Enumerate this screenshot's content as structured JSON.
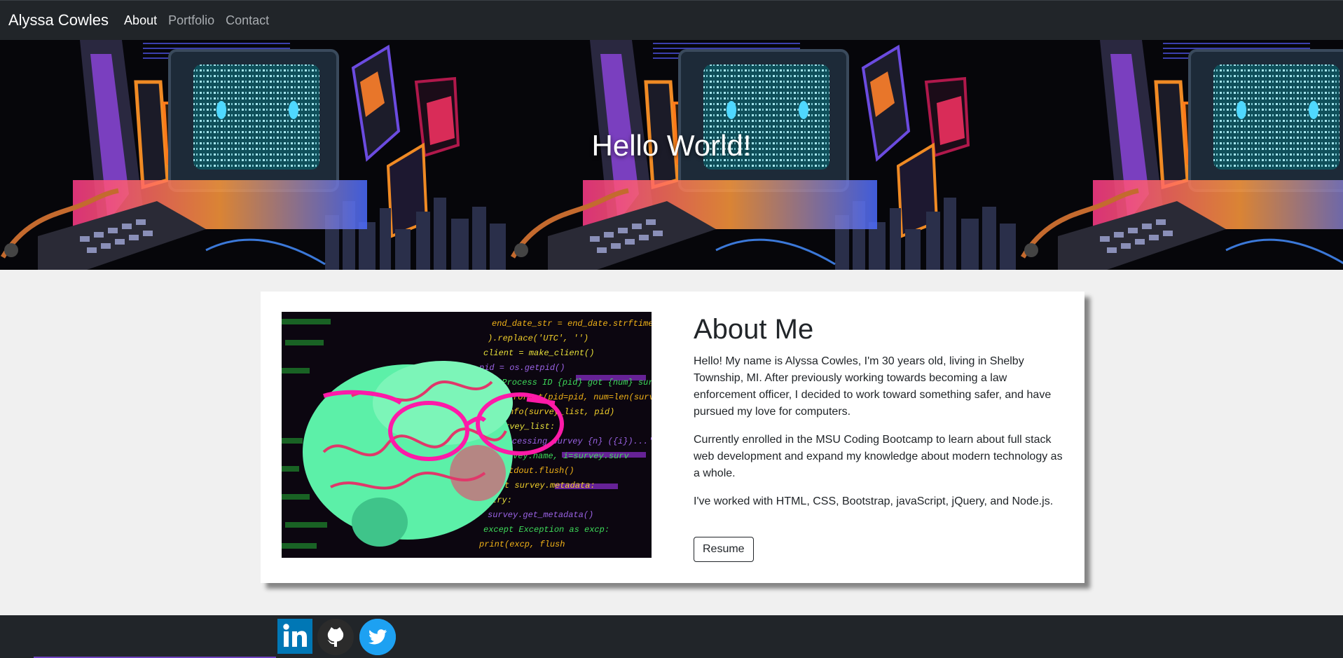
{
  "nav": {
    "brand": "Alyssa Cowles",
    "links": [
      "About",
      "Portfolio",
      "Contact"
    ],
    "active": "About"
  },
  "hero": {
    "title": "Hello World!"
  },
  "about": {
    "title": "About Me",
    "paragraphs": [
      "Hello! My name is Alyssa Cowles, I'm 30 years old, living in Shelby Township, MI. After previously working towards becoming a law enforcement officer, I decided to work toward something safer, and have pursued my love for computers.",
      "Currently enrolled in the MSU Coding Bootcamp to learn about full stack web development and expand my knowledge about modern technology as a whole.",
      "I've worked with HTML, CSS, Bootstrap, javaScript, jQuery, and Node.js."
    ],
    "resume_label": "Resume",
    "image_code_lines": [
      "end_date_str = end_date.strftime(",
      ").replace('UTC', '')",
      "client = make_client()",
      "pid = os.getpid()",
      "# Process ID {pid} got {num} surve",
      "(msg.format(pid=pid, num=len(surve",
      "log.info(survey_list, pid)",
      "in survey_list:",
      "'Processing survey {n} ({i})...'",
      "n=survey.name, i=survey.surv",
      "sys.stdout.flush()",
      "if not survey.metadata:",
      "try:",
      "survey.get_metadata()",
      "except Exception as excp:",
      "print(excp, flush"
    ]
  },
  "footer": {
    "icons": [
      "linkedin-icon",
      "github-icon",
      "twitter-icon"
    ]
  },
  "colors": {
    "navbar": "#212529",
    "page_bg": "#f0f0f0",
    "linkedin": "#0077b5",
    "twitter": "#1da1f2",
    "glasses": "#ff1aa8",
    "brain": "#5cf0a8"
  }
}
